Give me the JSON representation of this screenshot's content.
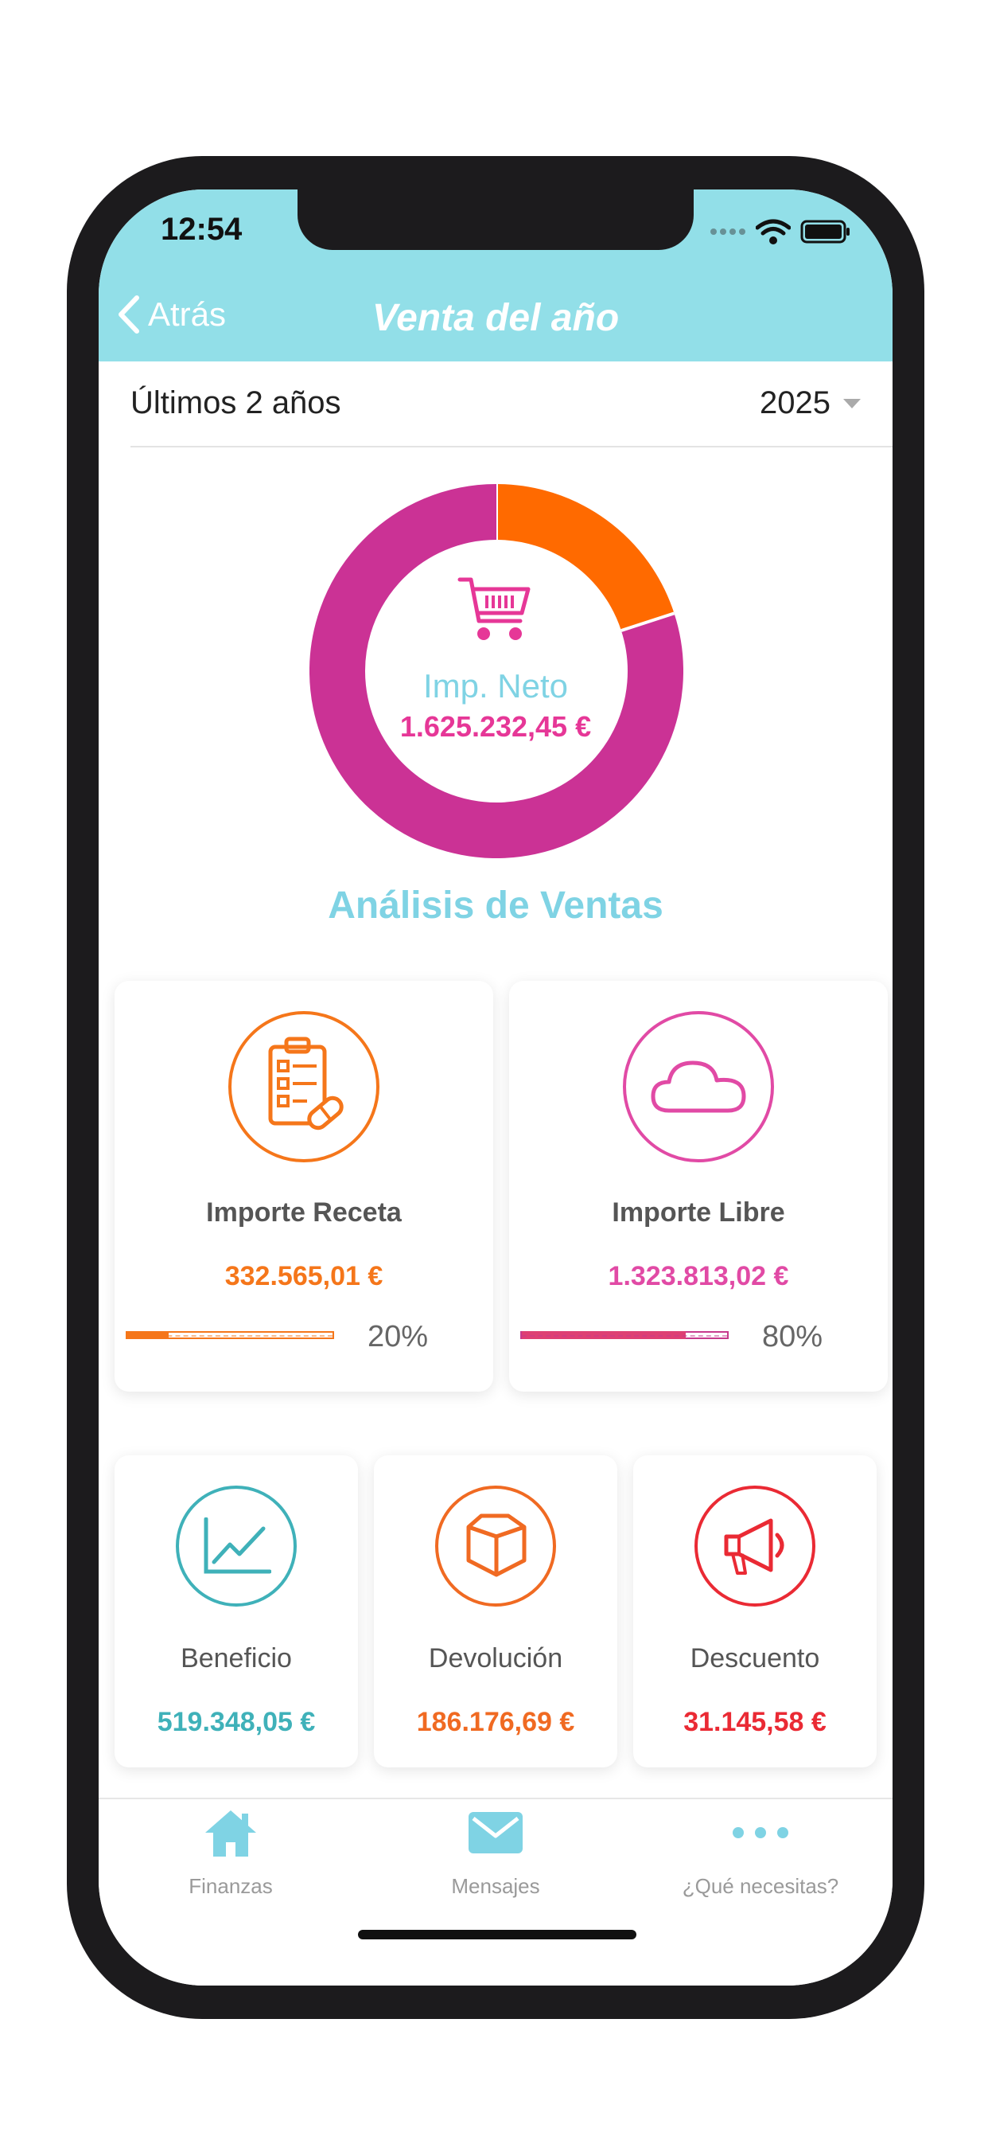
{
  "status": {
    "time": "12:54"
  },
  "nav": {
    "back_label": "Atrás",
    "title": "Venta del año"
  },
  "filter": {
    "range_label": "Últimos 2 años",
    "year": "2025"
  },
  "summary": {
    "label": "Imp. Neto",
    "value": "1.625.232,45 €",
    "donut_fractions": [
      0.2,
      0.8
    ],
    "colors": [
      "#ff6a00",
      "#cb3295"
    ]
  },
  "section_title": "Análisis de Ventas",
  "cards_top": [
    {
      "icon": "prescription-clipboard-icon",
      "label": "Importe Receta",
      "value": "332.565,01 €",
      "percent_label": "20%",
      "fraction": 0.2,
      "color": "#f5761a"
    },
    {
      "icon": "cloud-icon",
      "label": "Importe Libre",
      "value": "1.323.813,02 €",
      "percent_label": "80%",
      "fraction": 0.8,
      "color": "#e14aa5"
    }
  ],
  "cards_bottom": [
    {
      "icon": "line-chart-icon",
      "label": "Beneficio",
      "value": "519.348,05 €",
      "color": "#3fb1b9"
    },
    {
      "icon": "box-icon",
      "label": "Devolución",
      "value": "186.176,69 €",
      "color": "#f06a22"
    },
    {
      "icon": "megaphone-icon",
      "label": "Descuento",
      "value": "31.145,58 €",
      "color": "#ea2a34"
    }
  ],
  "tabs": [
    {
      "icon": "home-icon",
      "label": "Finanzas"
    },
    {
      "icon": "mail-icon",
      "label": "Mensajes"
    },
    {
      "icon": "more-dots-icon",
      "label": "¿Qué necesitas?"
    }
  ],
  "theme": {
    "header": "#92dfe8",
    "accent": "#7fd3e4",
    "pink": "#e63797"
  }
}
